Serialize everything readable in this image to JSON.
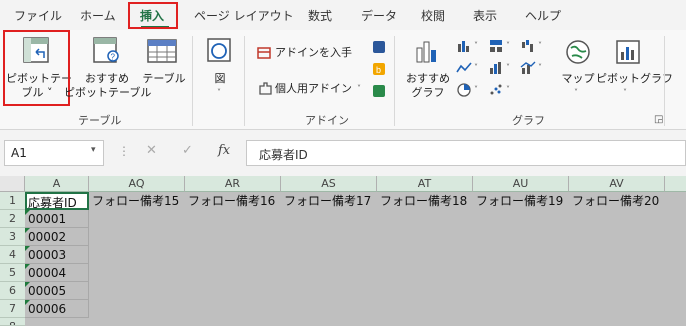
{
  "tabs": [
    {
      "label": "ファイル"
    },
    {
      "label": "ホーム"
    },
    {
      "label": "挿入"
    },
    {
      "label": "ページ レイアウト"
    },
    {
      "label": "数式"
    },
    {
      "label": "データ"
    },
    {
      "label": "校閲"
    },
    {
      "label": "表示"
    },
    {
      "label": "ヘルプ"
    }
  ],
  "ribbon": {
    "table_group": {
      "label": "テーブル",
      "pivot_line1": "ピボットテー",
      "pivot_line2": "ブル ˅",
      "rec_line1": "おすすめ",
      "rec_line2": "ピボットテーブル",
      "table": "テーブル"
    },
    "illust": {
      "label": "図"
    },
    "addin_group": {
      "label": "アドイン",
      "get": "アドインを入手",
      "personal": "個人用アドイン"
    },
    "chart_group": {
      "label": "グラフ",
      "rec_line1": "おすすめ",
      "rec_line2": "グラフ",
      "map": "マップ",
      "pivotchart": "ピボットグラフ"
    },
    "colors": {
      "accent": "#217346",
      "highlight": "#e02020"
    }
  },
  "formula_bar": {
    "name_box": "A1",
    "cancel": "✕",
    "enter": "✓",
    "fx": "fx",
    "content": "応募者ID"
  },
  "sheet": {
    "columns": [
      "A",
      "AQ",
      "AR",
      "AS",
      "AT",
      "AU",
      "AV"
    ],
    "rows": [
      "1",
      "2",
      "3",
      "4",
      "5",
      "6",
      "7",
      "8"
    ],
    "header_row": [
      "応募者ID",
      "フォロー備考15",
      "フォロー備考16",
      "フォロー備考17",
      "フォロー備考18",
      "フォロー備考19",
      "フォロー備考20"
    ],
    "ids": [
      "00001",
      "00002",
      "00003",
      "00004",
      "00005",
      "00006"
    ]
  }
}
